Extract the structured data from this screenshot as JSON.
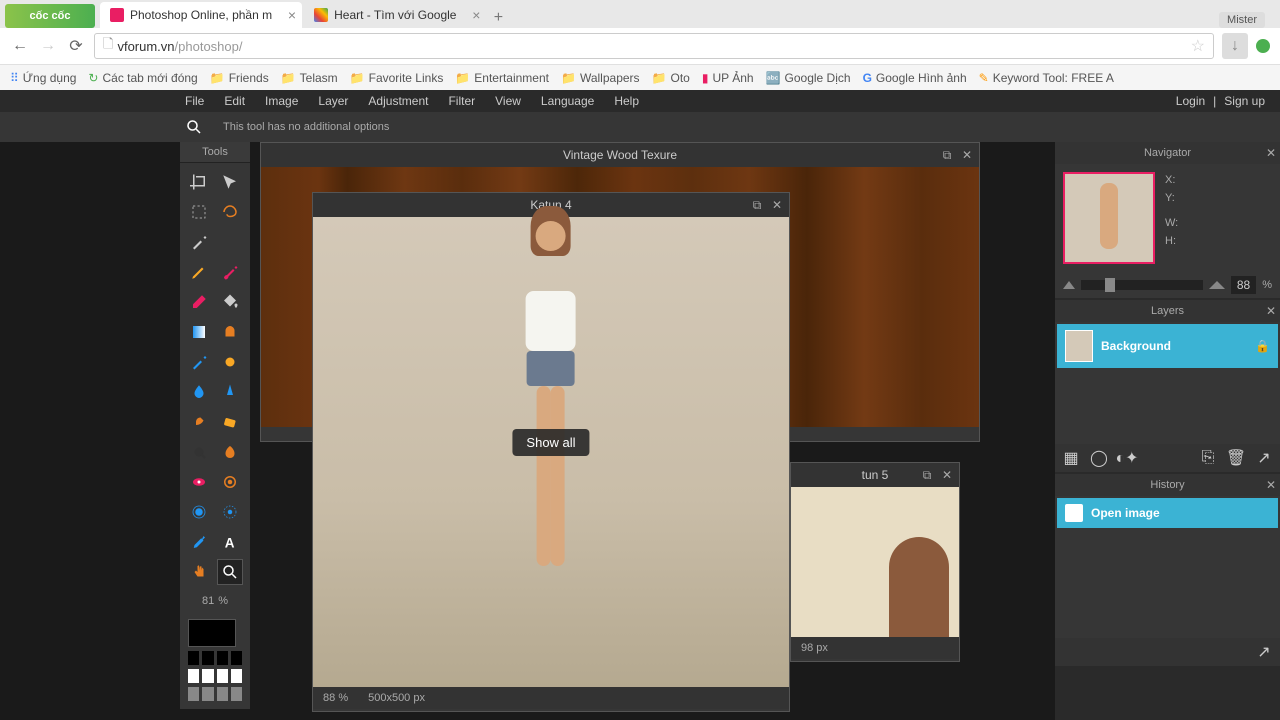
{
  "browser": {
    "logo": "cốc cốc",
    "tabs": [
      {
        "title": "Photoshop Online, phần m",
        "active": true
      },
      {
        "title": "Heart - Tìm với Google",
        "active": false
      }
    ],
    "user_button": "Mister",
    "url_host": "vforum.vn",
    "url_path": "/photoshop/",
    "bookmarks": [
      {
        "type": "apps",
        "label": "Ứng dụng"
      },
      {
        "type": "reload",
        "label": "Các tab mới đóng"
      },
      {
        "type": "folder",
        "label": "Friends"
      },
      {
        "type": "folder",
        "label": "Telasm"
      },
      {
        "type": "folder",
        "label": "Favorite Links"
      },
      {
        "type": "folder",
        "label": "Entertainment"
      },
      {
        "type": "folder",
        "label": "Wallpapers"
      },
      {
        "type": "folder",
        "label": "Oto"
      },
      {
        "type": "link",
        "label": "UP Ảnh"
      },
      {
        "type": "link",
        "label": "Google Dịch"
      },
      {
        "type": "link",
        "label": "Google Hình ảnh"
      },
      {
        "type": "link",
        "label": "Keyword Tool: FREE A"
      }
    ]
  },
  "app": {
    "menu": [
      "File",
      "Edit",
      "Image",
      "Layer",
      "Adjustment",
      "Filter",
      "View",
      "Language",
      "Help"
    ],
    "auth": {
      "login": "Login",
      "signup": "Sign up"
    },
    "options_text": "This tool has no additional options",
    "tools_title": "Tools",
    "tools_zoom": "81",
    "documents": {
      "doc1": {
        "title": "Vintage Wood Texure"
      },
      "doc2": {
        "title": "Katun 4",
        "zoom": "88",
        "dims": "500x500 px",
        "overlay": "Show all"
      },
      "doc3": {
        "title": "tun 5",
        "dims": "98 px"
      }
    },
    "navigator": {
      "title": "Navigator",
      "labels": {
        "x": "X:",
        "y": "Y:",
        "w": "W:",
        "h": "H:"
      },
      "zoom": "88"
    },
    "layers": {
      "title": "Layers",
      "items": [
        {
          "name": "Background"
        }
      ]
    },
    "history": {
      "title": "History",
      "items": [
        {
          "name": "Open image"
        }
      ]
    },
    "percent": "%"
  }
}
